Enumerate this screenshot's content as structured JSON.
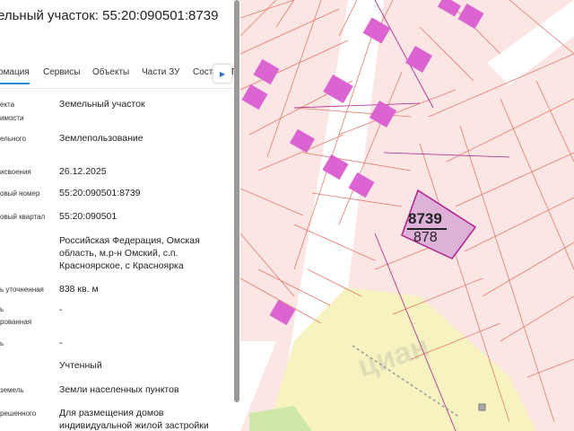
{
  "header": {
    "title": "ельный участок: 55:20:090501:8739"
  },
  "tabs": [
    {
      "label": "омация",
      "active": true
    },
    {
      "label": "Сервисы",
      "active": false
    },
    {
      "label": "Объекты",
      "active": false
    },
    {
      "label": "Части ЗУ",
      "active": false
    },
    {
      "label": "Соста",
      "active": false
    }
  ],
  "tabs_more_label": "Г",
  "properties": [
    {
      "label": "екта\nимости",
      "value": "Земельный участок"
    },
    {
      "label": "ельного",
      "value": "Землепользование"
    },
    {
      "label": "исвоения",
      "value": "26.12.2025"
    },
    {
      "label": "овый номер",
      "value": "55:20:090501:8739"
    },
    {
      "label": "овый квартал",
      "value": "55:20:090501"
    },
    {
      "label": "",
      "value": "Российская Федерация, Омская область, м.р-н Омский, с.п. Красноярское, с Красноярка"
    },
    {
      "label": "ь уточненная",
      "value": "838 кв. м"
    },
    {
      "label": "ь\nрованная",
      "value": "-"
    },
    {
      "label": "ь",
      "value": "-"
    },
    {
      "label": "",
      "value": "Учтенный"
    },
    {
      "label": "земель",
      "value": "Земли населенных пунктов"
    },
    {
      "label": "решенного",
      "value": "Для размещения домов индивидуальной жилой застройки"
    }
  ],
  "map": {
    "parcel_number": "8739",
    "parcel_area": "878",
    "colors": {
      "parcel_line": "#e8796a",
      "parcel_fill": "#fbe5e3",
      "highlight_fill": "#ddb1d8",
      "highlight_stroke": "#b21f8c",
      "building": "#db64d2",
      "zone_yellow": "#f6f3c1"
    }
  },
  "watermark": "циан"
}
